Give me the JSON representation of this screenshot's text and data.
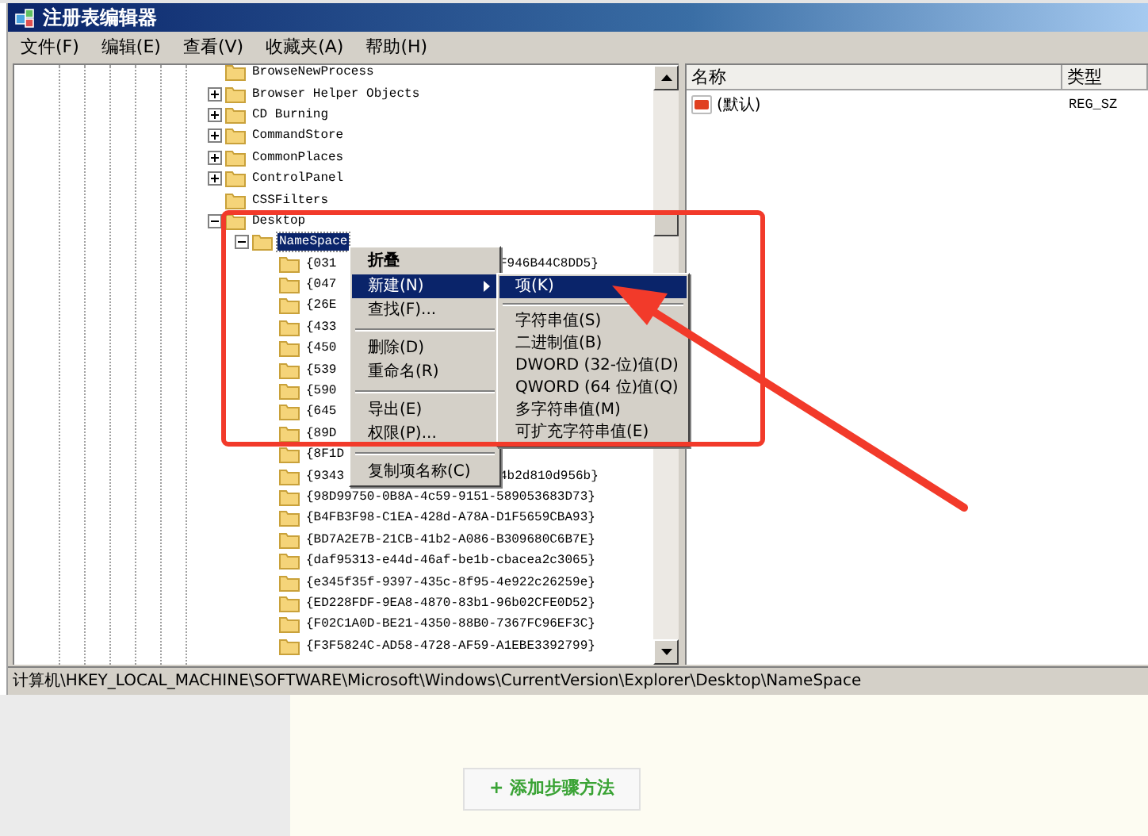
{
  "window": {
    "title": "注册表编辑器"
  },
  "menu_bar": [
    {
      "label": "文件(F)"
    },
    {
      "label": "编辑(E)"
    },
    {
      "label": "查看(V)"
    },
    {
      "label": "收藏夹(A)"
    },
    {
      "label": "帮助(H)"
    }
  ],
  "tree": [
    {
      "label": "BrowseNewProcess",
      "expandable": false,
      "selected": false
    },
    {
      "label": "Browser Helper Objects",
      "expandable": true,
      "expanded": false,
      "selected": false
    },
    {
      "label": "CD Burning",
      "expandable": true,
      "expanded": false,
      "selected": false
    },
    {
      "label": "CommandStore",
      "expandable": true,
      "expanded": false,
      "selected": false
    },
    {
      "label": "CommonPlaces",
      "expandable": true,
      "expanded": false,
      "selected": false
    },
    {
      "label": "ControlPanel",
      "expandable": true,
      "expanded": false,
      "selected": false
    },
    {
      "label": "CSSFilters",
      "expandable": false,
      "selected": false
    },
    {
      "label": "Desktop",
      "expandable": true,
      "expanded": true,
      "selected": false,
      "children": [
        {
          "label": "NameSpace",
          "expandable": true,
          "expanded": true,
          "selected": true,
          "children": [
            {
              "label": "{031",
              "tail": "F946B44C8DD5}",
              "expandable": false,
              "selected": false
            },
            {
              "label": "{047",
              "expandable": false,
              "selected": false
            },
            {
              "label": "{26E",
              "expandable": false,
              "selected": false
            },
            {
              "label": "{433",
              "expandable": false,
              "selected": false
            },
            {
              "label": "{450",
              "expandable": false,
              "selected": false
            },
            {
              "label": "{539",
              "expandable": false,
              "selected": false
            },
            {
              "label": "{590",
              "expandable": false,
              "selected": false
            },
            {
              "label": "{645",
              "expandable": false,
              "selected": false
            },
            {
              "label": "{89D",
              "expandable": false,
              "selected": false
            },
            {
              "label": "{8F1D",
              "expandable": false,
              "selected": false
            },
            {
              "label": "{9343",
              "tail": "4b2d810d956b}",
              "expandable": false,
              "selected": false
            },
            {
              "label": "{98D99750-0B8A-4c59-9151-589053683D73}",
              "expandable": false,
              "selected": false
            },
            {
              "label": "{B4FB3F98-C1EA-428d-A78A-D1F5659CBA93}",
              "expandable": false,
              "selected": false
            },
            {
              "label": "{BD7A2E7B-21CB-41b2-A086-B309680C6B7E}",
              "expandable": false,
              "selected": false
            },
            {
              "label": "{daf95313-e44d-46af-be1b-cbacea2c3065}",
              "expandable": false,
              "selected": false
            },
            {
              "label": "{e345f35f-9397-435c-8f95-4e922c26259e}",
              "expandable": false,
              "selected": false
            },
            {
              "label": "{ED228FDF-9EA8-4870-83b1-96b02CFE0D52}",
              "expandable": false,
              "selected": false
            },
            {
              "label": "{F02C1A0D-BE21-4350-88B0-7367FC96EF3C}",
              "expandable": false,
              "selected": false
            },
            {
              "label": "{F3F5824C-AD58-4728-AF59-A1EBE3392799}",
              "expandable": false,
              "selected": false
            }
          ]
        }
      ]
    }
  ],
  "values_pane": {
    "columns": [
      "名称",
      "类型"
    ],
    "rows": [
      {
        "name": "(默认)",
        "type": "REG_SZ"
      }
    ]
  },
  "context_menu": [
    {
      "kind": "item",
      "label": "折叠",
      "bold": true,
      "selected": false
    },
    {
      "kind": "submenu",
      "label": "新建(N)",
      "selected": true
    },
    {
      "kind": "item",
      "label": "查找(F)...",
      "selected": false
    },
    {
      "kind": "separator"
    },
    {
      "kind": "item",
      "label": "删除(D)",
      "selected": false
    },
    {
      "kind": "item",
      "label": "重命名(R)",
      "selected": false
    },
    {
      "kind": "separator"
    },
    {
      "kind": "item",
      "label": "导出(E)",
      "selected": false
    },
    {
      "kind": "item",
      "label": "权限(P)...",
      "selected": false
    },
    {
      "kind": "separator"
    },
    {
      "kind": "item",
      "label": "复制项名称(C)",
      "selected": false
    }
  ],
  "submenu": [
    {
      "kind": "item",
      "label": "项(K)",
      "selected": true
    },
    {
      "kind": "separator"
    },
    {
      "kind": "item",
      "label": "字符串值(S)",
      "selected": false
    },
    {
      "kind": "item",
      "label": "二进制值(B)",
      "selected": false
    },
    {
      "kind": "item",
      "label": "DWORD (32-位)值(D)",
      "selected": false
    },
    {
      "kind": "item",
      "label": "QWORD (64 位)值(Q)",
      "selected": false
    },
    {
      "kind": "item",
      "label": "多字符串值(M)",
      "selected": false
    },
    {
      "kind": "item",
      "label": "可扩充字符串值(E)",
      "selected": false
    }
  ],
  "status_bar": "计算机\\HKEY_LOCAL_MACHINE\\SOFTWARE\\Microsoft\\Windows\\CurrentVersion\\Explorer\\Desktop\\NameSpace",
  "page_button": {
    "label": "+ 添加步骤方法"
  }
}
